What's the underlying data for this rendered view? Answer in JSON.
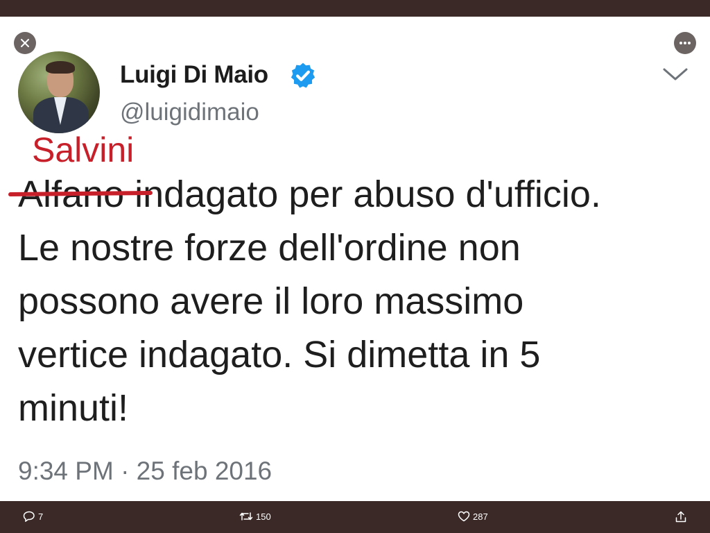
{
  "tweet": {
    "author_name": "Luigi Di Maio",
    "handle": "@luigidimaio",
    "overwritten_word": "Salvini",
    "struck_word": "Alfano",
    "text_after_strike": " indagato per abuso d'ufficio.",
    "text_lines": [
      "Le nostre forze dell'ordine non",
      "possono avere il loro massimo",
      "vertice indagato. Si dimetta in 5",
      "minuti!"
    ],
    "timestamp": "9:34 PM · 25 feb 2016"
  },
  "actions": {
    "reply_count": "7",
    "retweet_count": "150",
    "like_count": "287"
  },
  "colors": {
    "verified_blue": "#1d9bf0",
    "annotation_red": "#c8202a",
    "frame_dark": "#3a2927"
  },
  "icons": [
    "close-icon",
    "more-icon",
    "verified-icon",
    "chevron-down-icon",
    "reply-icon",
    "retweet-icon",
    "like-icon",
    "share-icon"
  ]
}
